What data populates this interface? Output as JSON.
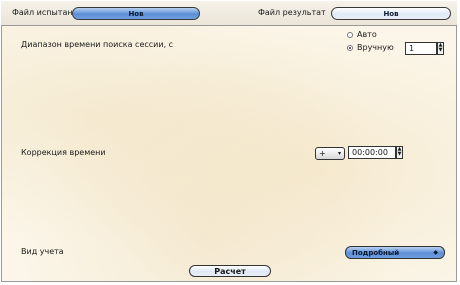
{
  "top": {
    "test_file_label": "Файл испытания",
    "test_file_button": "Нов",
    "result_file_label": "Файл результат",
    "result_file_button": "Нов"
  },
  "session_range": {
    "label": "Диапазон времени поиска сессии, с",
    "auto_label": "Авто",
    "manual_label": "Вручную",
    "manual_value": "1",
    "selected": "Вручную"
  },
  "time_correction": {
    "label": "Коррекция времени",
    "sign_value": "+",
    "time_value": "00:00:00"
  },
  "account_type": {
    "label": "Вид учета",
    "selected": "Подробный"
  },
  "actions": {
    "calculate": "Расчет"
  },
  "colors": {
    "accent_blue": "#5d8fd6",
    "panel_bg": "#fbf6e9"
  }
}
